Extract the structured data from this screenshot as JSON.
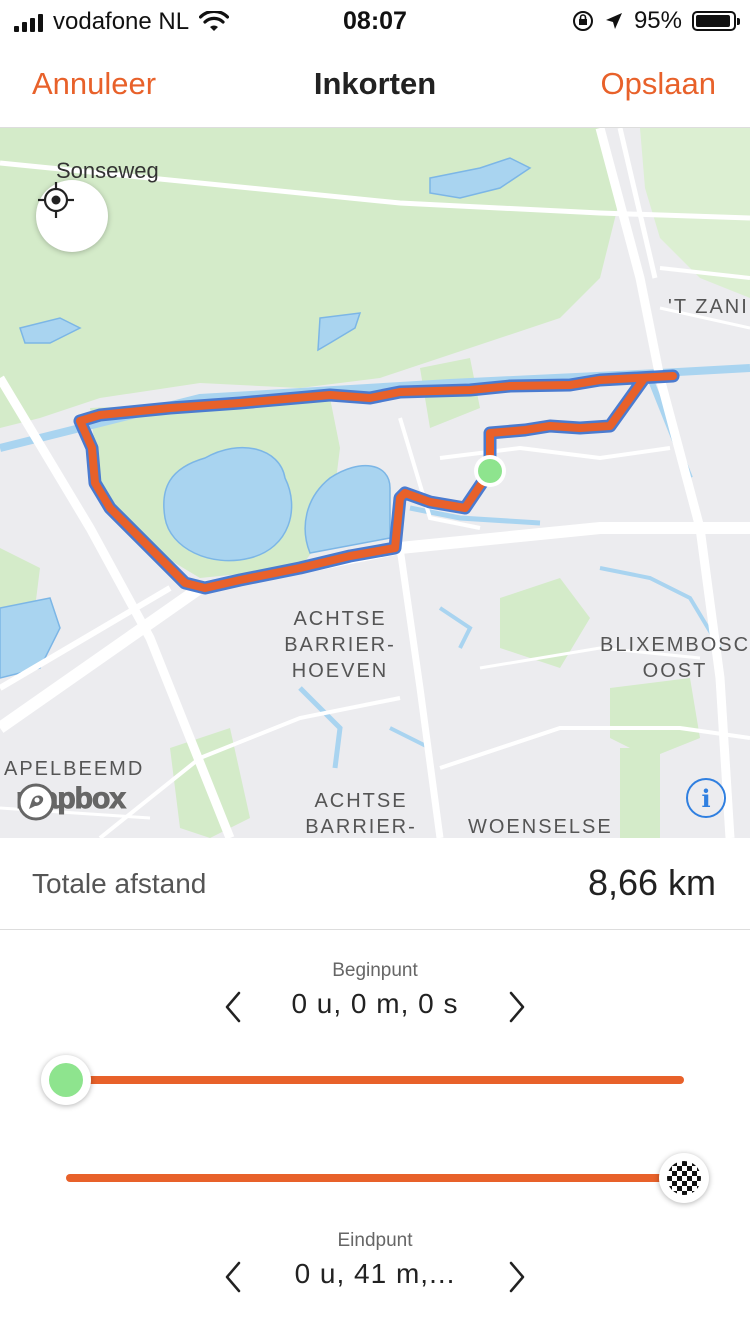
{
  "status_bar": {
    "carrier": "vodafone NL",
    "time": "08:07",
    "battery_percent": "95%",
    "battery_level": 0.95
  },
  "nav": {
    "cancel_label": "Annuleer",
    "title": "Inkorten",
    "save_label": "Opslaan"
  },
  "map": {
    "labels": {
      "sonseweg": "Sonseweg",
      "t_zand": "'T ZANI",
      "achtse_barrier_hoeven": "ACHTSE BARRIER- HOEVEN",
      "blixembosch_oost": "BLIXEMBOSC OOST",
      "apelbeemd": "APELBEEMD",
      "achtse_barrier": "ACHTSE BARRIER-",
      "woenselse": "WOENSELSE"
    },
    "attribution": "mapbox",
    "info_symbol": "i",
    "colors": {
      "route": "#e8612a",
      "start_marker": "#8ee48e",
      "water": "#a9d4f0",
      "park": "#d4ebc9"
    }
  },
  "distance": {
    "label": "Totale afstand",
    "value": "8,66 km"
  },
  "start": {
    "label": "Beginpunt",
    "value": "0 u, 0 m, 0 s",
    "position": 0
  },
  "end": {
    "label": "Eindpunt",
    "value": "0 u, 41 m,...",
    "position": 1
  },
  "colors": {
    "accent": "#e8612a",
    "info_blue": "#2f7fe0"
  }
}
